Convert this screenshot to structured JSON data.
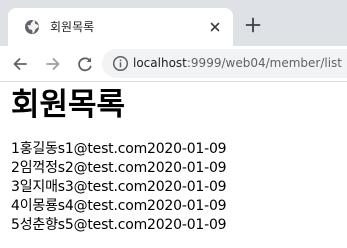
{
  "window": {
    "tab": {
      "title": "회원목록",
      "favicon": "globe-icon",
      "close_icon": "close-icon"
    },
    "new_tab_icon": "plus-icon"
  },
  "toolbar": {
    "back_icon": "arrow-left-icon",
    "forward_icon": "arrow-right-icon",
    "reload_icon": "reload-icon",
    "site_info_icon": "info-icon",
    "url_host": "localhost",
    "url_path": ":9999/web04/member/list"
  },
  "page": {
    "heading": "회원목록",
    "members": [
      {
        "no": "1",
        "name": "홍길동",
        "email": "s1@test.com",
        "date": "2020-01-09"
      },
      {
        "no": "2",
        "name": "임꺽정",
        "email": "s2@test.com",
        "date": "2020-01-09"
      },
      {
        "no": "3",
        "name": "일지매",
        "email": "s3@test.com",
        "date": "2020-01-09"
      },
      {
        "no": "4",
        "name": "이몽룡",
        "email": "s4@test.com",
        "date": "2020-01-09"
      },
      {
        "no": "5",
        "name": "성춘향",
        "email": "s5@test.com",
        "date": "2020-01-09"
      }
    ]
  },
  "colors": {
    "tabstrip": "#dee1e6",
    "omnibox": "#f1f3f4",
    "icon": "#5f6368",
    "text": "#000000"
  }
}
